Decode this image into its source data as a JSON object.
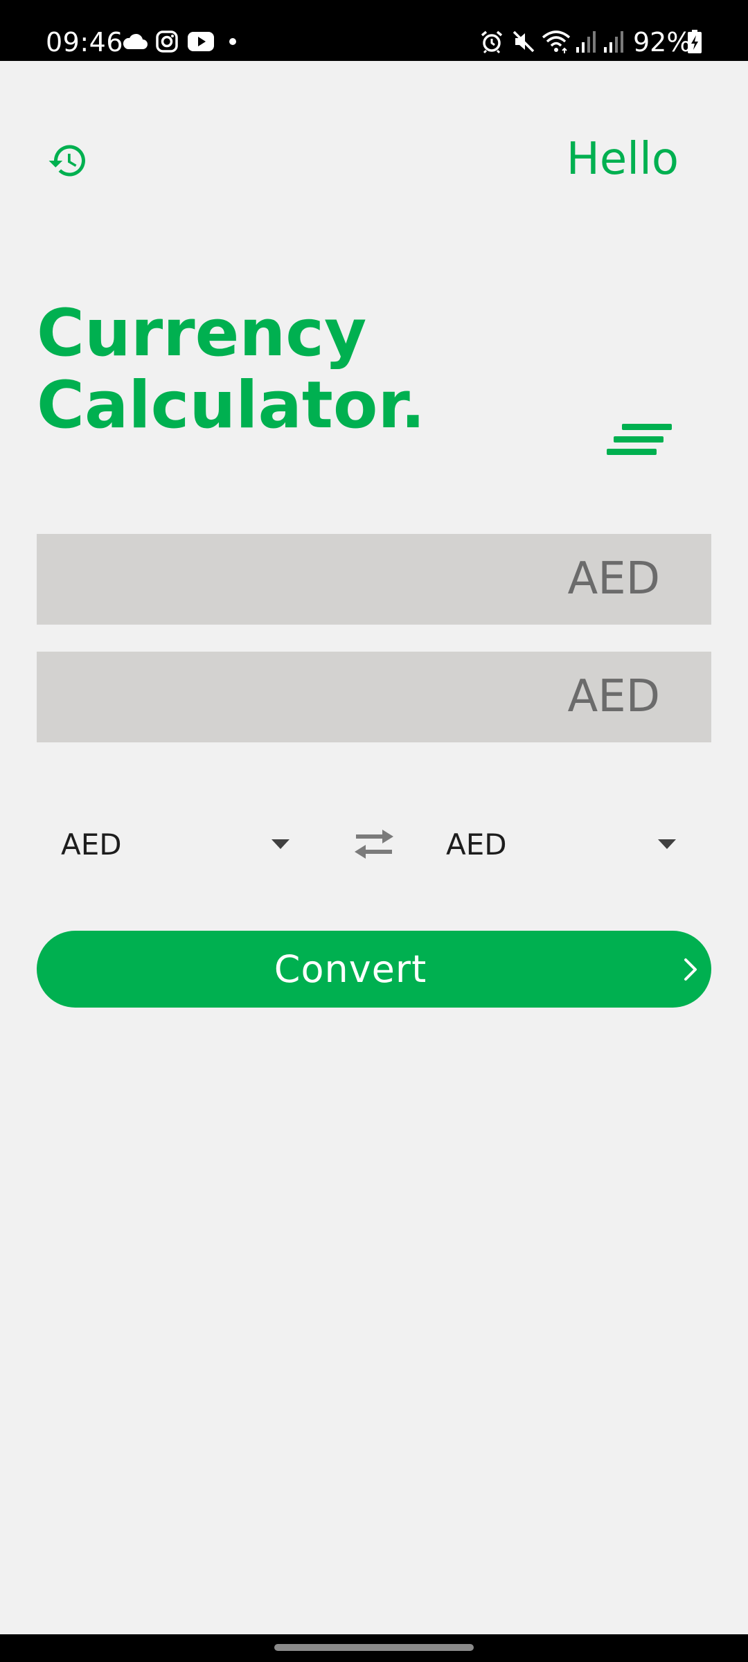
{
  "status_bar": {
    "time": "09:46",
    "battery": "92%",
    "left_icons": [
      "cloud-icon",
      "instagram-icon",
      "youtube-icon",
      "notification-dot-icon"
    ],
    "right_icons": [
      "alarm-icon",
      "mute-icon",
      "wifi-icon",
      "signal-icon",
      "signal-icon",
      "battery-charging-icon"
    ]
  },
  "header": {
    "history_icon": "history-icon",
    "greeting": "Hello",
    "title_line1": "Currency",
    "title_line2": "Calculator.",
    "menu_icon": "menu-icon"
  },
  "converter": {
    "amount_from": {
      "value": "",
      "currency": "AED"
    },
    "amount_to": {
      "value": "",
      "currency": "AED"
    },
    "from_currency": "AED",
    "to_currency": "AED",
    "swap_icon": "swap-arrows-icon",
    "convert_label": "Convert",
    "convert_icon": "chevron-right-icon"
  },
  "colors": {
    "accent": "#00b050",
    "background": "#f1f1f1",
    "field_background": "#d3d2d0",
    "muted_text": "#6b6b6b"
  }
}
